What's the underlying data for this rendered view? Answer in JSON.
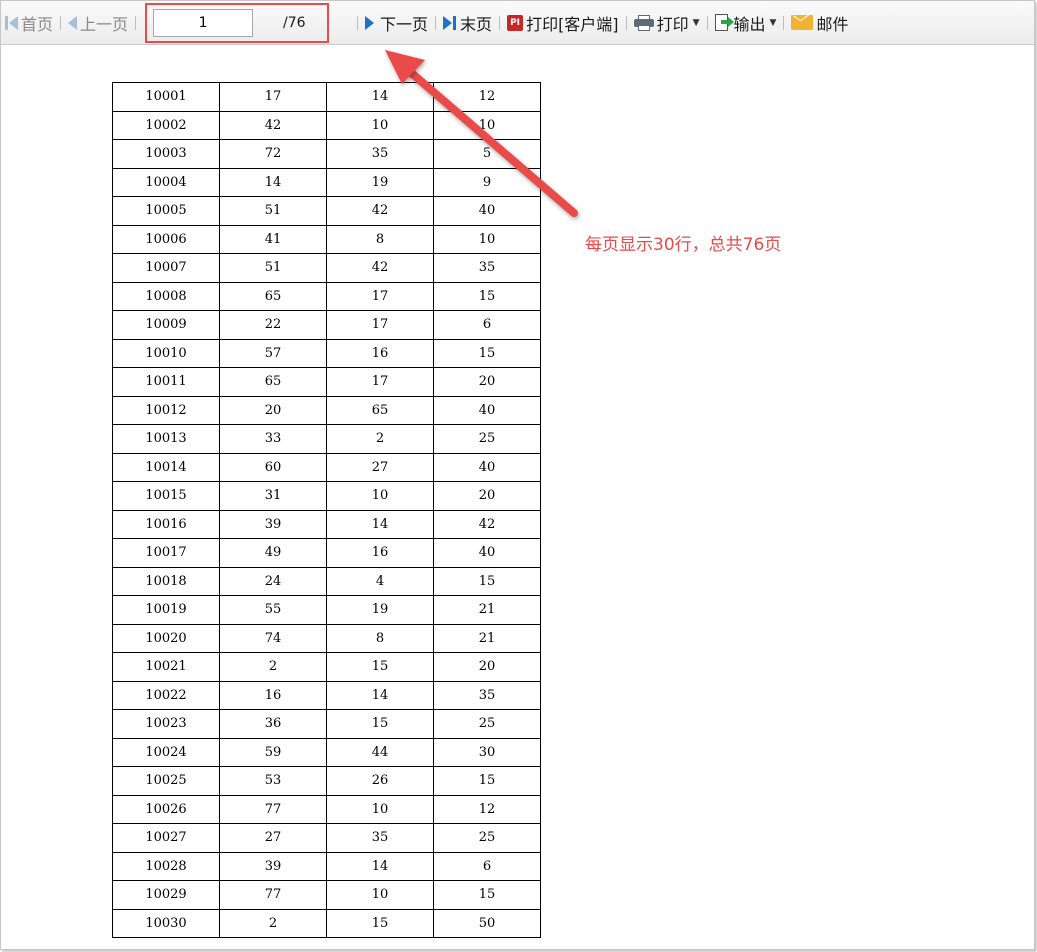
{
  "toolbar": {
    "first_page": "首页",
    "prev_page": "上一页",
    "page_value": "1",
    "page_total": "/76",
    "next_page": "下一页",
    "last_page": "末页",
    "print_client": "打印[客户端]",
    "print": "打印",
    "export": "输出",
    "email": "邮件"
  },
  "icons": {
    "first": "first-page-icon",
    "prev": "prev-page-icon",
    "next": "next-page-icon",
    "last": "last-page-icon",
    "pdf": "pdf-print-icon",
    "printer": "printer-icon",
    "export": "export-icon",
    "mail": "mail-icon"
  },
  "icon_labels": {
    "pdf": "PI"
  },
  "colors": {
    "annotation": "#e94a4a",
    "nav_disabled": "#a9bfd8",
    "nav_active": "#1c72c7"
  },
  "annotation": {
    "text": "每页显示30行，总共76页"
  },
  "table": {
    "rows": [
      [
        "10001",
        "17",
        "14",
        "12"
      ],
      [
        "10002",
        "42",
        "10",
        "10"
      ],
      [
        "10003",
        "72",
        "35",
        "5"
      ],
      [
        "10004",
        "14",
        "19",
        "9"
      ],
      [
        "10005",
        "51",
        "42",
        "40"
      ],
      [
        "10006",
        "41",
        "8",
        "10"
      ],
      [
        "10007",
        "51",
        "42",
        "35"
      ],
      [
        "10008",
        "65",
        "17",
        "15"
      ],
      [
        "10009",
        "22",
        "17",
        "6"
      ],
      [
        "10010",
        "57",
        "16",
        "15"
      ],
      [
        "10011",
        "65",
        "17",
        "20"
      ],
      [
        "10012",
        "20",
        "65",
        "40"
      ],
      [
        "10013",
        "33",
        "2",
        "25"
      ],
      [
        "10014",
        "60",
        "27",
        "40"
      ],
      [
        "10015",
        "31",
        "10",
        "20"
      ],
      [
        "10016",
        "39",
        "14",
        "42"
      ],
      [
        "10017",
        "49",
        "16",
        "40"
      ],
      [
        "10018",
        "24",
        "4",
        "15"
      ],
      [
        "10019",
        "55",
        "19",
        "21"
      ],
      [
        "10020",
        "74",
        "8",
        "21"
      ],
      [
        "10021",
        "2",
        "15",
        "20"
      ],
      [
        "10022",
        "16",
        "14",
        "35"
      ],
      [
        "10023",
        "36",
        "15",
        "25"
      ],
      [
        "10024",
        "59",
        "44",
        "30"
      ],
      [
        "10025",
        "53",
        "26",
        "15"
      ],
      [
        "10026",
        "77",
        "10",
        "12"
      ],
      [
        "10027",
        "27",
        "35",
        "25"
      ],
      [
        "10028",
        "39",
        "14",
        "6"
      ],
      [
        "10029",
        "77",
        "10",
        "15"
      ],
      [
        "10030",
        "2",
        "15",
        "50"
      ]
    ]
  }
}
